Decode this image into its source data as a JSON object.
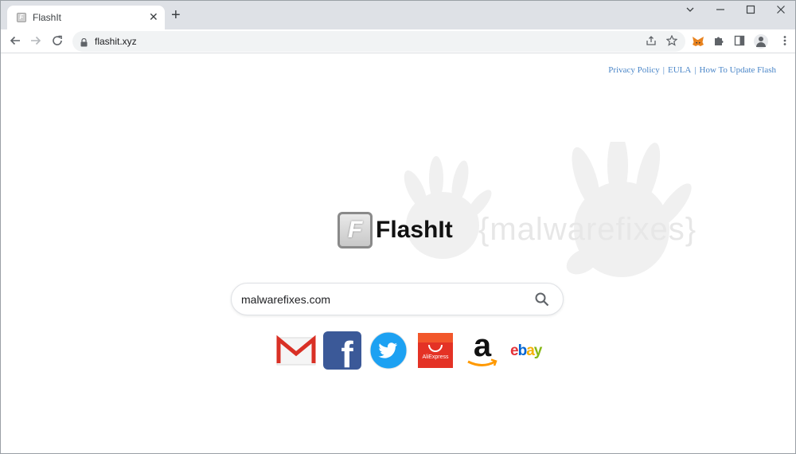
{
  "browser": {
    "tab_title": "FlashIt",
    "tab_favicon_letter": "F",
    "url": "flashit.xyz",
    "new_tab_label": "+",
    "tab_close_glyph": "✕"
  },
  "page": {
    "links": [
      {
        "label": "Privacy Policy"
      },
      {
        "label": "EULA"
      },
      {
        "label": "How To Update Flash"
      }
    ],
    "link_separator": "|",
    "logo_letter": "F",
    "logo_text": "FlashIt",
    "watermark_text": "{malwarefixes}",
    "search": {
      "value": "malwarefixes.com",
      "icon": "search-icon"
    },
    "shortcuts": [
      {
        "name": "gmail",
        "icon": "gmail-icon"
      },
      {
        "name": "facebook",
        "icon": "facebook-icon",
        "glyph": "f"
      },
      {
        "name": "twitter",
        "icon": "twitter-icon"
      },
      {
        "name": "aliexpress",
        "icon": "aliexpress-icon",
        "text": "AliExpress"
      },
      {
        "name": "amazon",
        "icon": "amazon-icon",
        "glyph": "a"
      },
      {
        "name": "ebay",
        "icon": "ebay-icon",
        "letters": [
          "e",
          "b",
          "a",
          "y"
        ]
      }
    ]
  },
  "colors": {
    "link": "#4a86c8",
    "facebook": "#3b5998",
    "twitter": "#1da1f2",
    "aliexpress": "#e43225",
    "gmail_red": "#d93025",
    "ebay": [
      "#e53238",
      "#0064d2",
      "#f5af02",
      "#86b817"
    ]
  }
}
